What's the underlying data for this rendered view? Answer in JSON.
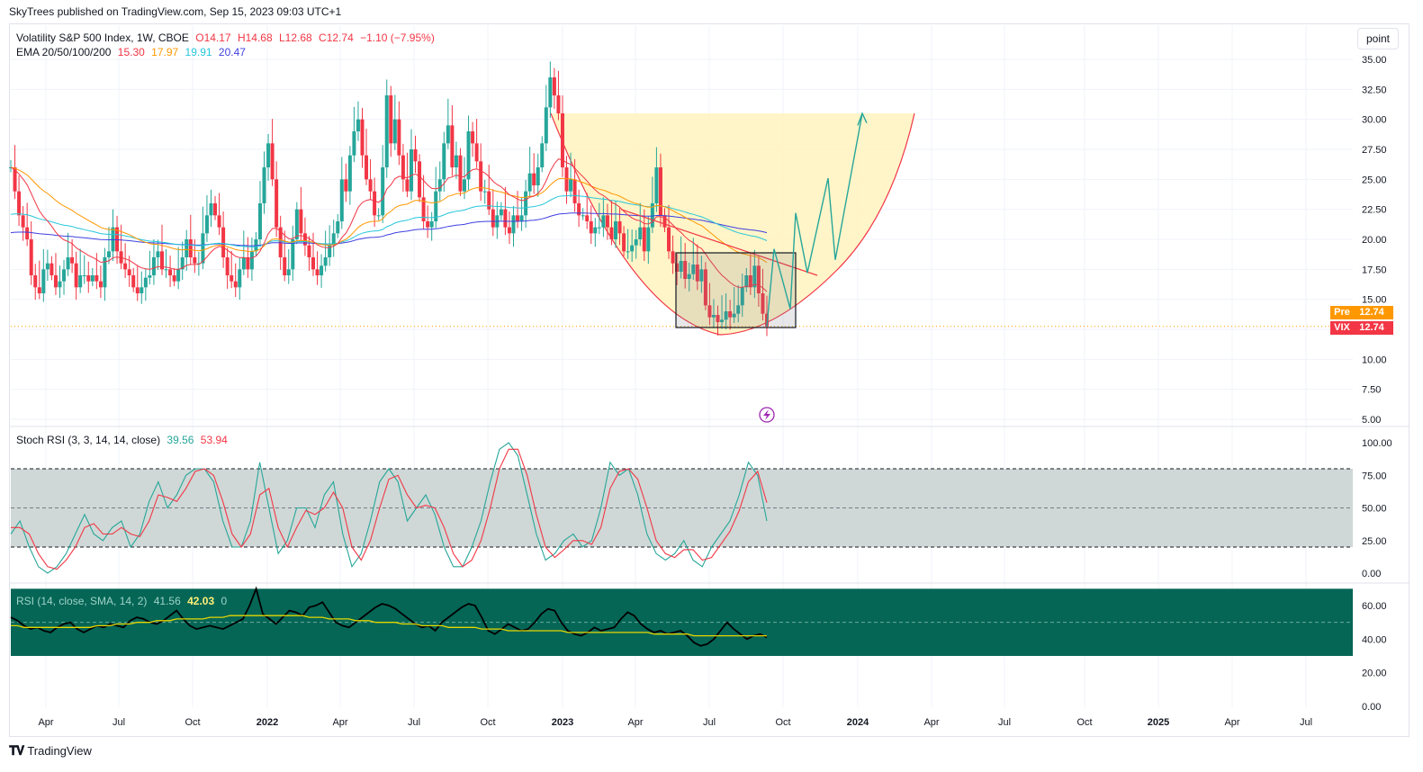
{
  "header": {
    "publisher_line": "SkyTrees published on TradingView.com, Sep 15, 2023 09:03 UTC+1"
  },
  "main_legend": {
    "symbol": "Volatility S&P 500 Index, 1W, CBOE",
    "o": "O14.17",
    "h": "H14.68",
    "l": "L12.68",
    "c": "C12.74",
    "change": "−1.10 (−7.95%)",
    "ema_label": "EMA 20/50/100/200",
    "ema_values": [
      "15.30",
      "17.97",
      "19.91",
      "20.47"
    ],
    "ema_colors": [
      "#f23645",
      "#ff9800",
      "#26c6da",
      "#3f3fe0"
    ]
  },
  "unit_button": "point",
  "price_tags": {
    "pre_label": "Pre",
    "pre_value": "12.74",
    "vix_label": "VIX",
    "vix_value": "12.74",
    "pre_color": "#ff9800",
    "vix_color": "#f23645"
  },
  "stoch_legend": {
    "label": "Stoch RSI (3, 3, 14, 14, close)",
    "k": "39.56",
    "d": "53.94",
    "k_color": "#26a69a",
    "d_color": "#f23645"
  },
  "rsi_legend": {
    "label": "RSI (14, close, SMA, 14, 2)",
    "rsi": "41.56",
    "sma": "42.03",
    "extra": "0"
  },
  "footer": {
    "brand": "TradingView"
  },
  "colors": {
    "up": "#26a69a",
    "down": "#f23645",
    "cup_fill": "#fff4c2",
    "stoch_band": "#cfd8d6",
    "rsi_band": "#056656"
  },
  "chart_data": [
    {
      "type": "candlestick",
      "title": "Volatility S&P 500 Index, 1W, CBOE",
      "ylim": [
        5,
        36.5
      ],
      "y_ticks": [
        "35.00",
        "32.50",
        "30.00",
        "27.50",
        "25.00",
        "22.50",
        "20.00",
        "17.50",
        "15.00",
        "12.50",
        "10.00",
        "7.50",
        "5.00"
      ],
      "x_ticks": [
        "Apr",
        "Jul",
        "Oct",
        "2022",
        "Apr",
        "Jul",
        "Oct",
        "2023",
        "Apr",
        "Jul",
        "Oct",
        "2024",
        "Apr",
        "Jul",
        "Oct",
        "2025",
        "Apr",
        "Jul"
      ],
      "last_close": 12.74,
      "ema_last": {
        "ema20": 15.3,
        "ema50": 17.97,
        "ema100": 19.91,
        "ema200": 20.47
      },
      "weekly_close_approx": [
        26,
        24,
        22,
        21,
        20,
        17,
        16,
        15.5,
        17.5,
        18,
        17,
        16,
        16.5,
        17.5,
        18.5,
        18,
        16,
        17,
        17,
        16.5,
        17,
        16.5,
        16,
        18.5,
        19,
        21,
        19,
        18,
        17.5,
        17,
        16,
        15.5,
        16,
        16.8,
        17,
        18.5,
        19,
        17.5,
        17.5,
        17,
        16.5,
        17.5,
        18.5,
        20,
        18.5,
        18,
        18,
        20.5,
        22,
        23,
        22,
        21,
        18.5,
        17,
        16.5,
        16,
        17.5,
        18.5,
        17.5,
        19,
        20,
        23,
        26,
        28,
        25,
        21,
        18.5,
        17,
        17.5,
        20,
        22.5,
        20.5,
        19.5,
        18.5,
        17.5,
        17,
        17.8,
        18.5,
        19.5,
        20.5,
        21.5,
        25,
        24,
        27,
        29,
        30,
        27,
        25,
        24,
        22,
        22,
        26,
        32,
        28,
        30,
        27,
        25,
        24,
        27.5,
        26.5,
        23.5,
        21.5,
        21,
        21.5,
        24,
        25,
        28,
        29.5,
        26,
        27,
        24,
        25,
        29,
        28,
        26.5,
        24,
        24,
        22.5,
        21,
        22,
        22.5,
        21,
        20.5,
        22,
        21.5,
        22,
        24,
        25.5,
        24.5,
        26,
        28,
        31,
        33.5,
        32,
        30.5,
        26,
        24,
        25,
        23,
        22,
        22,
        21.5,
        20.5,
        21,
        21,
        22,
        21,
        20,
        21.5,
        20.5,
        19,
        19,
        19.5,
        20,
        21,
        19,
        21,
        23,
        26,
        22,
        21,
        19,
        18,
        17.3,
        18.2,
        16.7,
        17.1,
        17.9,
        16.5,
        17.5,
        14.5,
        13.5,
        13.7,
        13.1,
        13.3,
        14,
        13.5,
        13.8,
        14.5,
        16,
        17,
        16,
        17.8,
        15.5,
        13.8,
        12.74
      ],
      "projection_path": [
        12.74,
        19.2,
        14.2,
        22.2,
        17.2,
        25.1,
        18.3,
        30.5
      ],
      "pattern": "cup-and-handle (annotation)"
    },
    {
      "type": "line",
      "title": "Stoch RSI (3, 3, 14, 14, close)",
      "ylim": [
        0,
        100
      ],
      "y_ticks": [
        "100.00",
        "75.00",
        "50.00",
        "25.00",
        "0.00"
      ],
      "bands": [
        20,
        50,
        80
      ],
      "series": [
        {
          "name": "K",
          "values": [
            30,
            40,
            20,
            5,
            0,
            5,
            15,
            30,
            45,
            30,
            25,
            35,
            40,
            20,
            30,
            55,
            70,
            50,
            60,
            75,
            80,
            80,
            70,
            40,
            20,
            20,
            40,
            85,
            50,
            15,
            25,
            50,
            50,
            35,
            60,
            70,
            30,
            5,
            15,
            40,
            70,
            80,
            70,
            40,
            50,
            60,
            45,
            20,
            5,
            5,
            20,
            40,
            70,
            95,
            100,
            90,
            60,
            30,
            10,
            15,
            25,
            30,
            20,
            25,
            50,
            85,
            75,
            80,
            60,
            30,
            15,
            10,
            15,
            25,
            10,
            5,
            20,
            30,
            40,
            60,
            85,
            75,
            40
          ]
        },
        {
          "name": "D",
          "values": [
            35,
            35,
            30,
            15,
            5,
            3,
            10,
            20,
            35,
            38,
            30,
            30,
            35,
            30,
            28,
            40,
            60,
            58,
            55,
            65,
            78,
            80,
            75,
            55,
            30,
            20,
            30,
            60,
            65,
            35,
            20,
            35,
            48,
            45,
            50,
            62,
            50,
            20,
            10,
            25,
            50,
            72,
            75,
            60,
            50,
            52,
            50,
            35,
            15,
            5,
            10,
            25,
            50,
            80,
            95,
            95,
            75,
            45,
            20,
            12,
            18,
            25,
            25,
            22,
            35,
            65,
            78,
            80,
            72,
            50,
            25,
            15,
            12,
            18,
            18,
            10,
            12,
            22,
            32,
            48,
            70,
            78,
            54
          ]
        }
      ]
    },
    {
      "type": "line",
      "title": "RSI (14, close, SMA, 14, 2)",
      "ylim": [
        0,
        70
      ],
      "y_ticks": [
        "60.00",
        "40.00",
        "20.00",
        "0.00"
      ],
      "band": [
        30,
        70
      ],
      "series": [
        {
          "name": "RSI",
          "values": [
            53,
            51,
            48,
            46,
            47,
            45,
            44,
            47,
            49,
            50,
            46,
            44,
            46,
            48,
            47,
            49,
            48,
            47,
            51,
            53,
            52,
            50,
            49,
            51,
            54,
            57,
            52,
            48,
            46,
            47,
            48,
            47,
            46,
            48,
            50,
            52,
            60,
            70,
            55,
            52,
            49,
            53,
            57,
            56,
            54,
            59,
            60,
            62,
            56,
            50,
            48,
            47,
            50,
            53,
            56,
            59,
            61,
            60,
            58,
            55,
            52,
            49,
            47,
            48,
            45,
            50,
            53,
            56,
            59,
            61,
            60,
            53,
            45,
            43,
            46,
            49,
            47,
            45,
            46,
            50,
            55,
            58,
            57,
            50,
            45,
            43,
            42,
            44,
            47,
            45,
            46,
            47,
            52,
            56,
            54,
            49,
            46,
            44,
            45,
            43,
            44,
            45,
            42,
            38,
            36,
            37,
            40,
            45,
            50,
            46,
            43,
            40,
            42,
            43,
            41
          ]
        },
        {
          "name": "SMA",
          "values": [
            48,
            48,
            47,
            47,
            47,
            47,
            47,
            47,
            47,
            47,
            47,
            47,
            47,
            48,
            48,
            48,
            49,
            49,
            49,
            50,
            50,
            50,
            51,
            51,
            51,
            52,
            52,
            52,
            52,
            52,
            53,
            53,
            53,
            54,
            54,
            54,
            54,
            54,
            54,
            54,
            54,
            54,
            54,
            54,
            54,
            53,
            53,
            53,
            52,
            52,
            52,
            52,
            51,
            51,
            51,
            50,
            50,
            50,
            50,
            49,
            49,
            49,
            48,
            48,
            48,
            48,
            47,
            47,
            47,
            47,
            47,
            46,
            46,
            46,
            46,
            45,
            45,
            45,
            45,
            45,
            45,
            45,
            45,
            45,
            44,
            44,
            44,
            44,
            44,
            44,
            44,
            44,
            44,
            44,
            44,
            44,
            44,
            43,
            43,
            43,
            43,
            43,
            43,
            42,
            42,
            42,
            42,
            42,
            42,
            42,
            42,
            42,
            42,
            42,
            42
          ]
        }
      ]
    }
  ]
}
